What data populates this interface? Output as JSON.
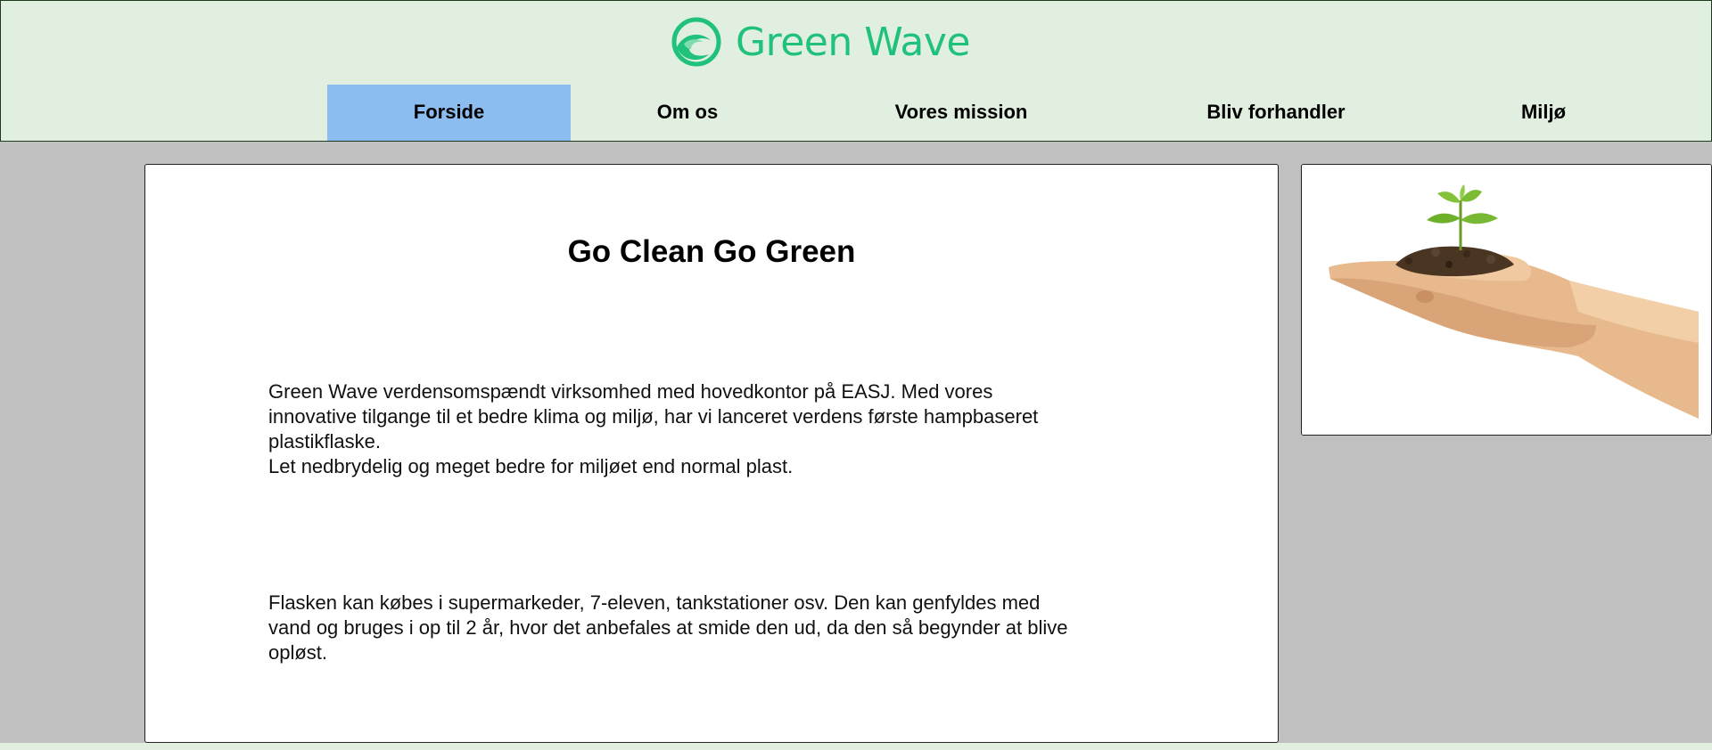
{
  "brand": {
    "name": "Green Wave",
    "color": "#1fc17b"
  },
  "nav": {
    "items": [
      {
        "label": "Forside",
        "active": true
      },
      {
        "label": "Om os",
        "active": false
      },
      {
        "label": "Vores mission",
        "active": false
      },
      {
        "label": "Bliv forhandler",
        "active": false
      },
      {
        "label": "Miljø",
        "active": false
      }
    ],
    "active_color": "#8bbdf0"
  },
  "main": {
    "title": "Go Clean Go Green",
    "paragraph_1": "Green Wave verdensomspændt virksomhed med hovedkontor på EASJ. Med vores\ninnovative tilgange til et bedre klima og miljø, har vi lanceret verdens første hampbaseret\nplastikflaske.\nLet nedbrydelig og meget bedre for miljøet end normal plast.",
    "paragraph_2": "Flasken kan købes i supermarkeder, 7-eleven, tankstationer osv. Den kan genfyldes med\nvand og bruges i op til 2 år, hvor det anbefales at smide den ud, da den så begynder at blive\nopløst."
  },
  "sidebar": {
    "image": "hand-holding-seedling-image"
  },
  "colors": {
    "header_bg": "#e0efdf",
    "page_bg": "#c0c0c0"
  }
}
